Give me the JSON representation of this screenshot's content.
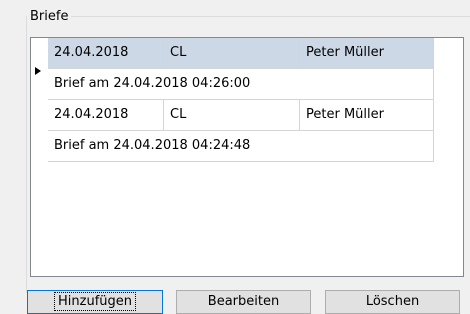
{
  "groupbox": {
    "title": "Briefe"
  },
  "grid": {
    "rows": [
      {
        "date": "24.04.2018",
        "code": "CL",
        "name": "Peter Müller",
        "detail": "Brief am 24.04.2018 04:26:00",
        "selected": true
      },
      {
        "date": "24.04.2018",
        "code": "CL",
        "name": "Peter Müller",
        "detail": "Brief am 24.04.2018 04:24:48",
        "selected": false
      }
    ]
  },
  "buttons": {
    "add_label": "Hinzufügen",
    "edit_label": "Bearbeiten",
    "delete_label": "Löschen"
  },
  "colors": {
    "selected_row": "#cdd8e6",
    "grid_border": "#828790",
    "default_button_border": "#0078d7"
  }
}
